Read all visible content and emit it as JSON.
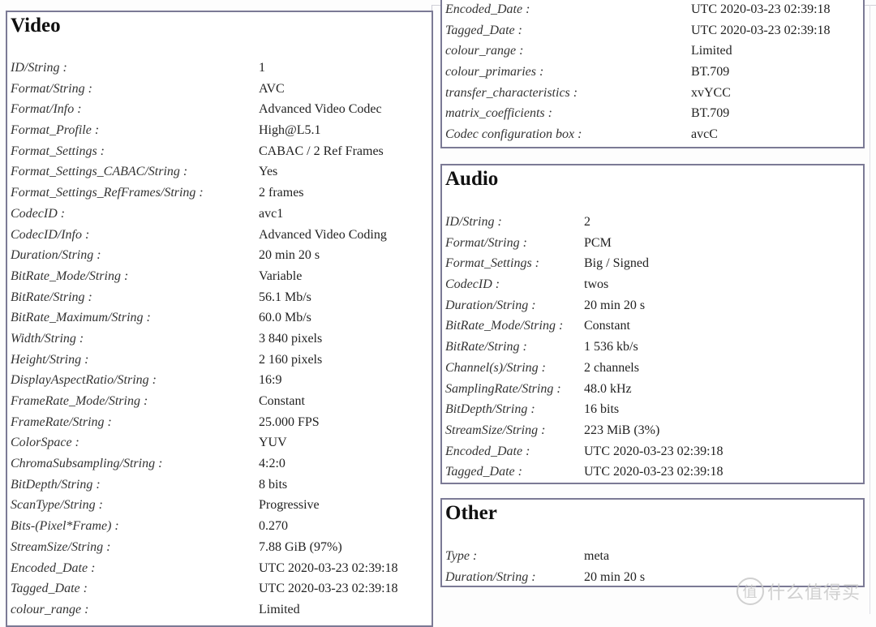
{
  "video": {
    "title": "Video",
    "rows": [
      {
        "key": "ID/String :",
        "value": "1"
      },
      {
        "key": "Format/String :",
        "value": "AVC"
      },
      {
        "key": "Format/Info :",
        "value": "Advanced Video Codec"
      },
      {
        "key": "Format_Profile :",
        "value": "High@L5.1"
      },
      {
        "key": "Format_Settings :",
        "value": "CABAC / 2 Ref Frames"
      },
      {
        "key": "Format_Settings_CABAC/String :",
        "value": "Yes"
      },
      {
        "key": "Format_Settings_RefFrames/String :",
        "value": "2 frames"
      },
      {
        "key": "CodecID :",
        "value": "avc1"
      },
      {
        "key": "CodecID/Info :",
        "value": "Advanced Video Coding"
      },
      {
        "key": "Duration/String :",
        "value": "20 min 20 s"
      },
      {
        "key": "BitRate_Mode/String :",
        "value": "Variable"
      },
      {
        "key": "BitRate/String :",
        "value": "56.1 Mb/s"
      },
      {
        "key": "BitRate_Maximum/String :",
        "value": "60.0 Mb/s"
      },
      {
        "key": "Width/String :",
        "value": "3 840 pixels"
      },
      {
        "key": "Height/String :",
        "value": "2 160 pixels"
      },
      {
        "key": "DisplayAspectRatio/String :",
        "value": "16:9"
      },
      {
        "key": "FrameRate_Mode/String :",
        "value": "Constant"
      },
      {
        "key": "FrameRate/String :",
        "value": "25.000 FPS"
      },
      {
        "key": "ColorSpace :",
        "value": "YUV"
      },
      {
        "key": "ChromaSubsampling/String :",
        "value": "4:2:0"
      },
      {
        "key": "BitDepth/String :",
        "value": "8 bits"
      },
      {
        "key": "ScanType/String :",
        "value": "Progressive"
      },
      {
        "key": "Bits-(Pixel*Frame) :",
        "value": "0.270"
      },
      {
        "key": "StreamSize/String :",
        "value": "7.88 GiB (97%)"
      },
      {
        "key": "Encoded_Date :",
        "value": "UTC 2020-03-23 02:39:18"
      },
      {
        "key": "Tagged_Date :",
        "value": "UTC 2020-03-23 02:39:18"
      },
      {
        "key": "colour_range :",
        "value": "Limited"
      }
    ]
  },
  "video_continued": {
    "rows": [
      {
        "key": "Encoded_Date :",
        "value": "UTC 2020-03-23 02:39:18"
      },
      {
        "key": "Tagged_Date :",
        "value": "UTC 2020-03-23 02:39:18"
      },
      {
        "key": "colour_range :",
        "value": "Limited"
      },
      {
        "key": "colour_primaries :",
        "value": "BT.709"
      },
      {
        "key": "transfer_characteristics :",
        "value": "xvYCC"
      },
      {
        "key": "matrix_coefficients :",
        "value": "BT.709"
      },
      {
        "key": "Codec configuration box :",
        "value": "avcC"
      }
    ]
  },
  "audio": {
    "title": "Audio",
    "rows": [
      {
        "key": "ID/String :",
        "value": "2"
      },
      {
        "key": "Format/String :",
        "value": "PCM"
      },
      {
        "key": "Format_Settings :",
        "value": "Big / Signed"
      },
      {
        "key": "CodecID :",
        "value": "twos"
      },
      {
        "key": "Duration/String :",
        "value": "20 min 20 s"
      },
      {
        "key": "BitRate_Mode/String :",
        "value": "Constant"
      },
      {
        "key": "BitRate/String :",
        "value": "1 536 kb/s"
      },
      {
        "key": "Channel(s)/String :",
        "value": "2 channels"
      },
      {
        "key": "SamplingRate/String :",
        "value": "48.0 kHz"
      },
      {
        "key": "BitDepth/String :",
        "value": "16 bits"
      },
      {
        "key": "StreamSize/String :",
        "value": "223 MiB (3%)"
      },
      {
        "key": "Encoded_Date :",
        "value": "UTC 2020-03-23 02:39:18"
      },
      {
        "key": "Tagged_Date :",
        "value": "UTC 2020-03-23 02:39:18"
      }
    ]
  },
  "other": {
    "title": "Other",
    "rows": [
      {
        "key": "Type :",
        "value": "meta"
      },
      {
        "key": "Duration/String :",
        "value": "20 min 20 s"
      }
    ]
  },
  "watermark": {
    "circle_char": "值",
    "text": "什么值得买"
  },
  "colors": {
    "border": "#7b7a95",
    "background": "#ffffff",
    "text": "#222222"
  }
}
